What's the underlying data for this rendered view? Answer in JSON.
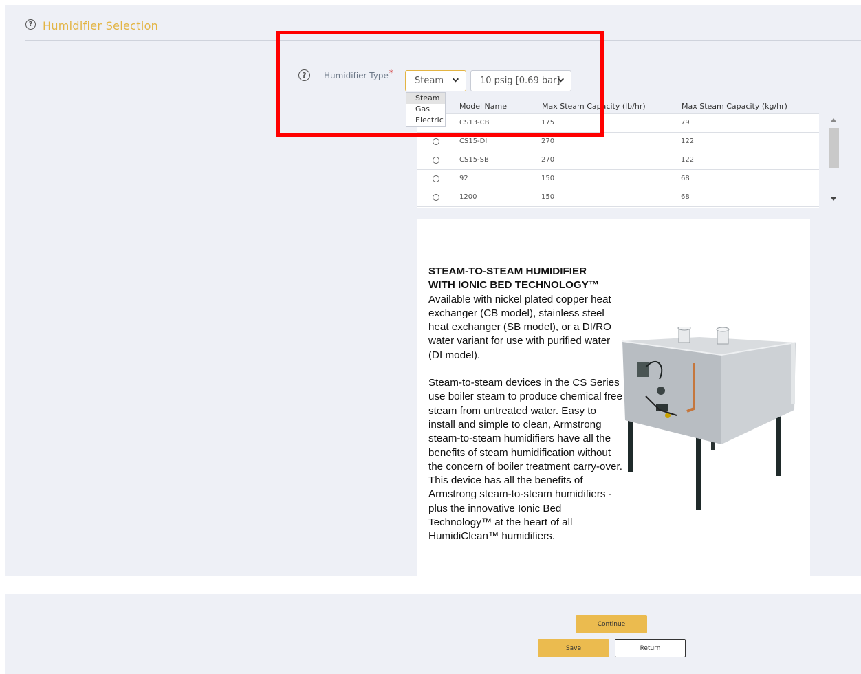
{
  "section": {
    "title": "Humidifier Selection"
  },
  "form": {
    "type_label": "Humidifier Type",
    "required_mark": "*",
    "type_selected": "Steam",
    "type_options": [
      "Steam",
      "Gas",
      "Electric"
    ],
    "pressure_selected": "10 psig [0.69 bar]"
  },
  "table": {
    "headers": [
      "Model Name",
      "Max Steam Capacity (lb/hr)",
      "Max Steam Capacity (kg/hr)"
    ],
    "rows": [
      {
        "model": "CS13-CB",
        "lbhr": "175",
        "kghr": "79"
      },
      {
        "model": "CS15-DI",
        "lbhr": "270",
        "kghr": "122"
      },
      {
        "model": "CS15-SB",
        "lbhr": "270",
        "kghr": "122"
      },
      {
        "model": "92",
        "lbhr": "150",
        "kghr": "68"
      },
      {
        "model": "1200",
        "lbhr": "150",
        "kghr": "68"
      }
    ]
  },
  "info": {
    "title_line1": "STEAM-TO-STEAM HUMIDIFIER",
    "title_line2": "WITH IONIC BED TECHNOLOGY™",
    "para1": "Available with nickel plated copper heat exchanger (CB model), stainless steel heat exchanger (SB model), or a DI/RO water variant for use with purified water (DI model).",
    "para2": "Steam-to-steam devices in the CS Series use boiler steam to produce chemical free steam from untreated water. Easy to install and simple to clean, Armstrong steam-to-steam humidifiers have all the benefits of steam humidification without the concern of boiler treatment carry-over. This device has all the benefits of Armstrong steam-to-steam humidifiers - plus the innovative Ionic Bed Technology™ at the heart of all HumidiClean™ humidifiers."
  },
  "buttons": {
    "continue": "Continue",
    "save": "Save",
    "return": "Return"
  },
  "icons": {
    "help": "help-circle-icon",
    "chevron": "chevron-down-icon"
  },
  "colors": {
    "accent": "#e3b443",
    "button": "#ebbb4f",
    "required": "#d23030",
    "highlight_box": "#ff0000"
  }
}
